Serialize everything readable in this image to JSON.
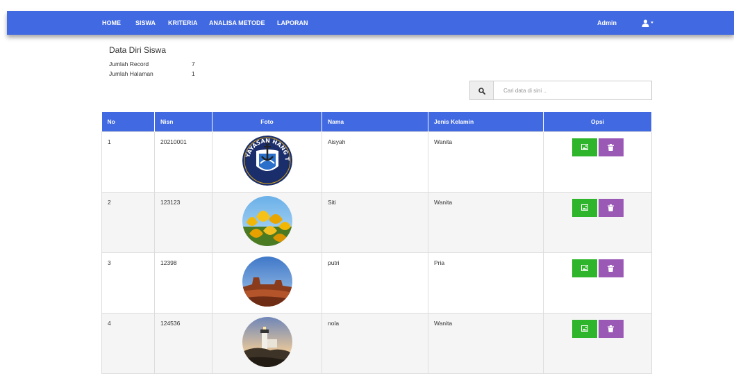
{
  "nav": {
    "items": [
      "HOME",
      "SISWA",
      "KRITERIA",
      "ANALISA METODE",
      "LAPORAN"
    ],
    "user_label": "Admin",
    "user_icon": "user-icon"
  },
  "page": {
    "title": "Data Diri Siswa",
    "jumlah_record_label": "Jumlah Record",
    "jumlah_record_value": "7",
    "jumlah_halaman_label": "Jumlah Halaman",
    "jumlah_halaman_value": "1"
  },
  "search": {
    "icon": "search-icon",
    "placeholder": "Cari data di sini .."
  },
  "table": {
    "headers": [
      "No",
      "Nisn",
      "Foto",
      "Nama",
      "Jenis Kelamin",
      "Opsi"
    ],
    "rows": [
      {
        "no": "1",
        "nisn": "20210001",
        "foto": "logo-yayasan-hang-tuah",
        "nama": "Aisyah",
        "jenis_kelamin": "Wanita",
        "logo_text": "YAYASAN HANG TUAH"
      },
      {
        "no": "2",
        "nisn": "123123",
        "foto": "tulips-photo",
        "nama": "Siti",
        "jenis_kelamin": "Wanita"
      },
      {
        "no": "3",
        "nisn": "12398",
        "foto": "desert-photo",
        "nama": "putri",
        "jenis_kelamin": "Pria"
      },
      {
        "no": "4",
        "nisn": "124536",
        "foto": "lighthouse-photo",
        "nama": "nola",
        "jenis_kelamin": "Wanita"
      }
    ],
    "actions": {
      "edit_icon": "image-icon",
      "delete_icon": "trash-icon"
    }
  },
  "colors": {
    "navbar": "#4169e1",
    "header": "#4169e1",
    "edit_button": "#2fb52b",
    "delete_button": "#9b59b6"
  }
}
